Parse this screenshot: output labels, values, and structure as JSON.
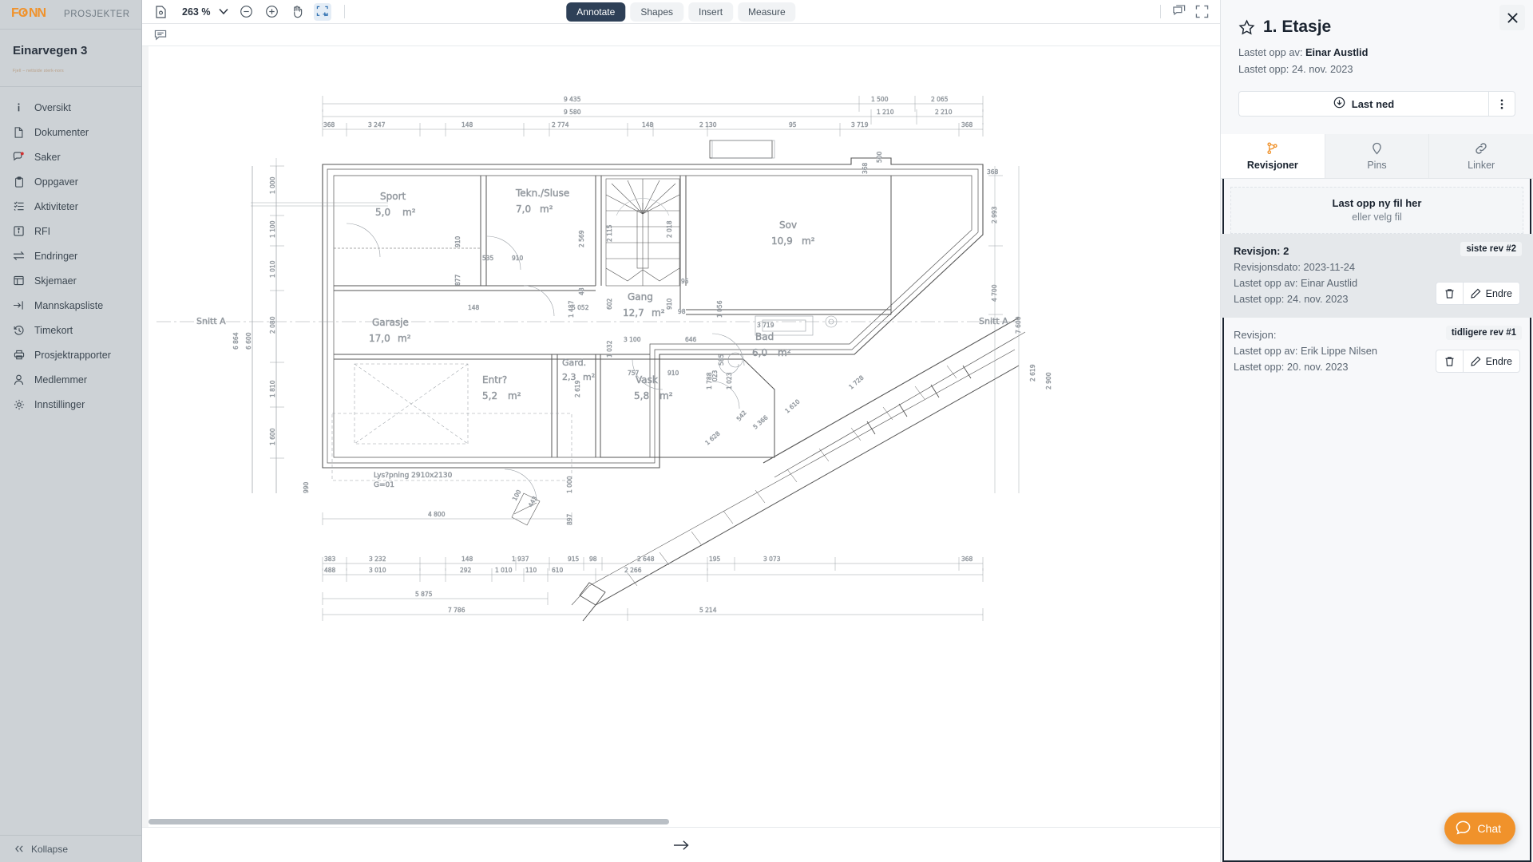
{
  "sidebar": {
    "logo": "FONN",
    "top_nav": "PROSJEKTER",
    "project_name": "Einarvegen 3",
    "project_sub": "Fjell – nettside sterk-nors",
    "items": [
      {
        "label": "Oversikt",
        "icon": "info-icon"
      },
      {
        "label": "Dokumenter",
        "icon": "document-icon"
      },
      {
        "label": "Saker",
        "icon": "chat-alert-icon"
      },
      {
        "label": "Oppgaver",
        "icon": "clipboard-icon"
      },
      {
        "label": "Aktiviteter",
        "icon": "list-check-icon"
      },
      {
        "label": "RFI",
        "icon": "info-box-icon"
      },
      {
        "label": "Endringer",
        "icon": "exchange-icon"
      },
      {
        "label": "Skjemaer",
        "icon": "form-icon"
      },
      {
        "label": "Mannskapsliste",
        "icon": "login-arrow-icon"
      },
      {
        "label": "Timekort",
        "icon": "clock-history-icon"
      },
      {
        "label": "Prosjektrapporter",
        "icon": "printer-icon"
      },
      {
        "label": "Medlemmer",
        "icon": "user-icon"
      },
      {
        "label": "Innstillinger",
        "icon": "gear-icon"
      }
    ],
    "collapse_label": "Kollapse"
  },
  "toolbar": {
    "page_icon": "page-settings-icon",
    "zoom_level": "263 %",
    "zoom_out_icon": "minus-circle-icon",
    "zoom_in_icon": "plus-circle-icon",
    "pan_icon": "hand-icon",
    "select_icon": "marquee-select-icon",
    "modes": [
      {
        "label": "Annotate",
        "active": true
      },
      {
        "label": "Shapes",
        "active": false
      },
      {
        "label": "Insert",
        "active": false
      },
      {
        "label": "Measure",
        "active": false
      }
    ],
    "comment_icon": "comment-stack-icon",
    "fullscreen_icon": "fullscreen-icon",
    "subbar_comment_icon": "comment-icon",
    "next_page_icon": "arrow-right-icon"
  },
  "panel": {
    "title": "1. Etasje",
    "favorite_icon": "star-icon",
    "close_icon": "close-icon",
    "uploaded_by_label": "Lastet opp av:",
    "uploaded_by": "Einar Austlid",
    "uploaded_on_label": "Lastet opp:",
    "uploaded_on": "24. nov. 2023",
    "download_label": "Last ned",
    "download_icon": "download-cloud-icon",
    "more_icon": "kebab-menu-icon",
    "tabs": [
      {
        "label": "Revisjoner",
        "icon": "branch-icon",
        "active": true
      },
      {
        "label": "Pins",
        "icon": "pin-icon",
        "active": false
      },
      {
        "label": "Linker",
        "icon": "link-icon",
        "active": false
      }
    ],
    "dropzone": {
      "main": "Last opp ny fil her",
      "sub": "eller velg fil"
    },
    "revisions": [
      {
        "title": "Revisjon: 2",
        "badge": "siste rev #2",
        "date_line": "Revisjonsdato: 2023-11-24",
        "by_line": "Lastet opp av: Einar Austlid",
        "on_line": "Lastet opp: 24. nov. 2023",
        "delete_icon": "trash-icon",
        "edit_icon": "pencil-icon",
        "edit_label": "Endre",
        "selected": true
      },
      {
        "title": "Revisjon:",
        "badge": "tidligere rev #1",
        "date_line": "",
        "by_line": "Lastet opp av: Erik Lippe Nilsen",
        "on_line": "Lastet opp: 20. nov. 2023",
        "delete_icon": "trash-icon",
        "edit_icon": "pencil-icon",
        "edit_label": "Endre",
        "selected": false
      }
    ],
    "chat": {
      "label": "Chat",
      "icon": "chat-bubble-icon"
    }
  },
  "plan": {
    "section_left": "Snitt  A",
    "section_right": "Snitt  A",
    "note": "Lys?pning  2910x2130",
    "note2": "G=01",
    "rooms": [
      {
        "name": "Sport",
        "area": "5,0",
        "unit": "m²"
      },
      {
        "name": "Tekn./Sluse",
        "area": "7,0",
        "unit": "m²"
      },
      {
        "name": "Gang",
        "area": "12,7",
        "unit": "m²"
      },
      {
        "name": "Sov",
        "area": "10,9",
        "unit": "m²"
      },
      {
        "name": "Garasje",
        "area": "17,0",
        "unit": "m²"
      },
      {
        "name": "Entr?",
        "area": "5,2",
        "unit": "m²"
      },
      {
        "name": "Gard.",
        "area": "2,3",
        "unit": "m²"
      },
      {
        "name": "Vask",
        "area": "5,8",
        "unit": "m²"
      },
      {
        "name": "Bad",
        "area": "6,0",
        "unit": "m²"
      }
    ],
    "dims_top": [
      "9 435",
      "1 500",
      "2 065",
      "9 580",
      "1 210",
      "2 210",
      "368",
      "3 247",
      "148",
      "2 774",
      "148",
      "2 130",
      "95",
      "3 719",
      "368"
    ],
    "dims_bottom": [
      "383",
      "3 232",
      "148",
      "1 937",
      "915",
      "98",
      "2 648",
      "195",
      "3 073",
      "368",
      "488",
      "3 010",
      "292",
      "1 010",
      "110",
      "610",
      "2 266",
      "5 875",
      "7 786",
      "5 214",
      "4 800"
    ],
    "dims_left": [
      "1 000",
      "1 100",
      "1 010",
      "2 080",
      "6 600",
      "6 864",
      "1 810",
      "1 600",
      "990",
      "897"
    ],
    "dims_right": [
      "2 993",
      "4 700",
      "7 600",
      "2 619",
      "2 900",
      "1 728",
      "1 610",
      "1 628",
      "5 366"
    ],
    "dims_inner": [
      "368",
      "368",
      "910",
      "877",
      "535",
      "910",
      "2 569",
      "602",
      "2 115",
      "1 032",
      "148",
      "5 052",
      "3 100",
      "646",
      "757",
      "910",
      "1 788",
      "2 619",
      "1 023",
      "3 719",
      "1 056",
      "542",
      "585",
      "023",
      "100",
      "910",
      "98",
      "368",
      "500",
      "95"
    ]
  }
}
